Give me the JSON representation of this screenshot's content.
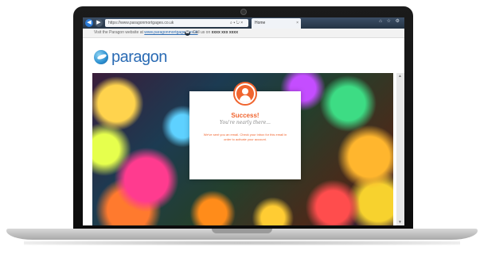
{
  "browser": {
    "url": "https://www.paragonmortgages.co.uk",
    "address_controls": "⌕ ▾ ↻ ×",
    "tab_label": "Home",
    "tab_close": "×",
    "window_controls": "⌂ ☆ ⚙",
    "back": "◀",
    "forward": "▶"
  },
  "infobar": {
    "visit_text": "Visit the Paragon website at",
    "visit_link": "www.paragonmortgages.co.uk",
    "phone_icon": "☎",
    "call_text": "Call us on",
    "phone_number": "xxxx xxx xxxx"
  },
  "brand": {
    "logo_text": "paragon",
    "accent": "#f0642e",
    "brand_blue": "#2a6bb4"
  },
  "modal": {
    "title": "Success!",
    "subtitle": "You're nearly there...",
    "message": "We've sent you an email. Check your inbox for this email in order to activate your account."
  },
  "scrollbar": {
    "up": "▲",
    "down": "▼"
  }
}
